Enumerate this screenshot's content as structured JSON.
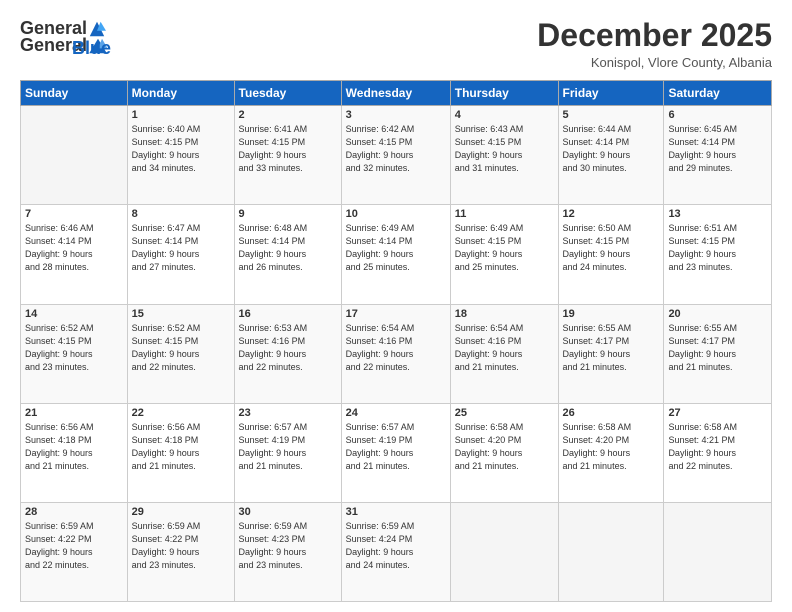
{
  "logo": {
    "general": "General",
    "blue": "Blue"
  },
  "header": {
    "month": "December 2025",
    "location": "Konispol, Vlore County, Albania"
  },
  "weekdays": [
    "Sunday",
    "Monday",
    "Tuesday",
    "Wednesday",
    "Thursday",
    "Friday",
    "Saturday"
  ],
  "weeks": [
    [
      {
        "day": "",
        "info": ""
      },
      {
        "day": "1",
        "info": "Sunrise: 6:40 AM\nSunset: 4:15 PM\nDaylight: 9 hours\nand 34 minutes."
      },
      {
        "day": "2",
        "info": "Sunrise: 6:41 AM\nSunset: 4:15 PM\nDaylight: 9 hours\nand 33 minutes."
      },
      {
        "day": "3",
        "info": "Sunrise: 6:42 AM\nSunset: 4:15 PM\nDaylight: 9 hours\nand 32 minutes."
      },
      {
        "day": "4",
        "info": "Sunrise: 6:43 AM\nSunset: 4:15 PM\nDaylight: 9 hours\nand 31 minutes."
      },
      {
        "day": "5",
        "info": "Sunrise: 6:44 AM\nSunset: 4:14 PM\nDaylight: 9 hours\nand 30 minutes."
      },
      {
        "day": "6",
        "info": "Sunrise: 6:45 AM\nSunset: 4:14 PM\nDaylight: 9 hours\nand 29 minutes."
      }
    ],
    [
      {
        "day": "7",
        "info": "Sunrise: 6:46 AM\nSunset: 4:14 PM\nDaylight: 9 hours\nand 28 minutes."
      },
      {
        "day": "8",
        "info": "Sunrise: 6:47 AM\nSunset: 4:14 PM\nDaylight: 9 hours\nand 27 minutes."
      },
      {
        "day": "9",
        "info": "Sunrise: 6:48 AM\nSunset: 4:14 PM\nDaylight: 9 hours\nand 26 minutes."
      },
      {
        "day": "10",
        "info": "Sunrise: 6:49 AM\nSunset: 4:14 PM\nDaylight: 9 hours\nand 25 minutes."
      },
      {
        "day": "11",
        "info": "Sunrise: 6:49 AM\nSunset: 4:15 PM\nDaylight: 9 hours\nand 25 minutes."
      },
      {
        "day": "12",
        "info": "Sunrise: 6:50 AM\nSunset: 4:15 PM\nDaylight: 9 hours\nand 24 minutes."
      },
      {
        "day": "13",
        "info": "Sunrise: 6:51 AM\nSunset: 4:15 PM\nDaylight: 9 hours\nand 23 minutes."
      }
    ],
    [
      {
        "day": "14",
        "info": "Sunrise: 6:52 AM\nSunset: 4:15 PM\nDaylight: 9 hours\nand 23 minutes."
      },
      {
        "day": "15",
        "info": "Sunrise: 6:52 AM\nSunset: 4:15 PM\nDaylight: 9 hours\nand 22 minutes."
      },
      {
        "day": "16",
        "info": "Sunrise: 6:53 AM\nSunset: 4:16 PM\nDaylight: 9 hours\nand 22 minutes."
      },
      {
        "day": "17",
        "info": "Sunrise: 6:54 AM\nSunset: 4:16 PM\nDaylight: 9 hours\nand 22 minutes."
      },
      {
        "day": "18",
        "info": "Sunrise: 6:54 AM\nSunset: 4:16 PM\nDaylight: 9 hours\nand 21 minutes."
      },
      {
        "day": "19",
        "info": "Sunrise: 6:55 AM\nSunset: 4:17 PM\nDaylight: 9 hours\nand 21 minutes."
      },
      {
        "day": "20",
        "info": "Sunrise: 6:55 AM\nSunset: 4:17 PM\nDaylight: 9 hours\nand 21 minutes."
      }
    ],
    [
      {
        "day": "21",
        "info": "Sunrise: 6:56 AM\nSunset: 4:18 PM\nDaylight: 9 hours\nand 21 minutes."
      },
      {
        "day": "22",
        "info": "Sunrise: 6:56 AM\nSunset: 4:18 PM\nDaylight: 9 hours\nand 21 minutes."
      },
      {
        "day": "23",
        "info": "Sunrise: 6:57 AM\nSunset: 4:19 PM\nDaylight: 9 hours\nand 21 minutes."
      },
      {
        "day": "24",
        "info": "Sunrise: 6:57 AM\nSunset: 4:19 PM\nDaylight: 9 hours\nand 21 minutes."
      },
      {
        "day": "25",
        "info": "Sunrise: 6:58 AM\nSunset: 4:20 PM\nDaylight: 9 hours\nand 21 minutes."
      },
      {
        "day": "26",
        "info": "Sunrise: 6:58 AM\nSunset: 4:20 PM\nDaylight: 9 hours\nand 21 minutes."
      },
      {
        "day": "27",
        "info": "Sunrise: 6:58 AM\nSunset: 4:21 PM\nDaylight: 9 hours\nand 22 minutes."
      }
    ],
    [
      {
        "day": "28",
        "info": "Sunrise: 6:59 AM\nSunset: 4:22 PM\nDaylight: 9 hours\nand 22 minutes."
      },
      {
        "day": "29",
        "info": "Sunrise: 6:59 AM\nSunset: 4:22 PM\nDaylight: 9 hours\nand 23 minutes."
      },
      {
        "day": "30",
        "info": "Sunrise: 6:59 AM\nSunset: 4:23 PM\nDaylight: 9 hours\nand 23 minutes."
      },
      {
        "day": "31",
        "info": "Sunrise: 6:59 AM\nSunset: 4:24 PM\nDaylight: 9 hours\nand 24 minutes."
      },
      {
        "day": "",
        "info": ""
      },
      {
        "day": "",
        "info": ""
      },
      {
        "day": "",
        "info": ""
      }
    ]
  ]
}
